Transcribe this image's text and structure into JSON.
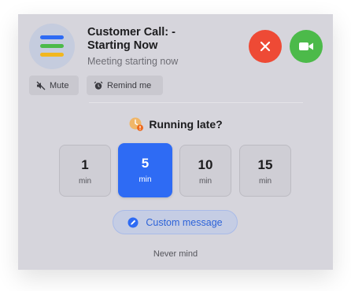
{
  "meeting": {
    "title": "Customer Call: - Starting Now",
    "status": "Meeting starting now",
    "app_icon": "stacked-bars-icon",
    "app_icon_colors": [
      "#2e6bf4",
      "#4cba4a",
      "#f2b71f"
    ]
  },
  "actions": {
    "decline_icon": "close-icon",
    "decline_color": "#ee4a35",
    "join_icon": "video-camera-icon",
    "join_color": "#4cba4a",
    "mute_label": "Mute",
    "mute_icon": "speaker-muted-icon",
    "remind_label": "Remind me",
    "remind_icon": "alarm-clock-icon"
  },
  "running_late": {
    "label": "Running late?",
    "icon": "clock-alert-icon",
    "options": [
      {
        "value": "1",
        "unit": "min",
        "selected": false
      },
      {
        "value": "5",
        "unit": "min",
        "selected": true
      },
      {
        "value": "10",
        "unit": "min",
        "selected": false
      },
      {
        "value": "15",
        "unit": "min",
        "selected": false
      }
    ],
    "selected_color": "#2e6bf4",
    "custom_message_label": "Custom message",
    "custom_message_icon": "compose-icon",
    "dismiss_label": "Never mind"
  }
}
